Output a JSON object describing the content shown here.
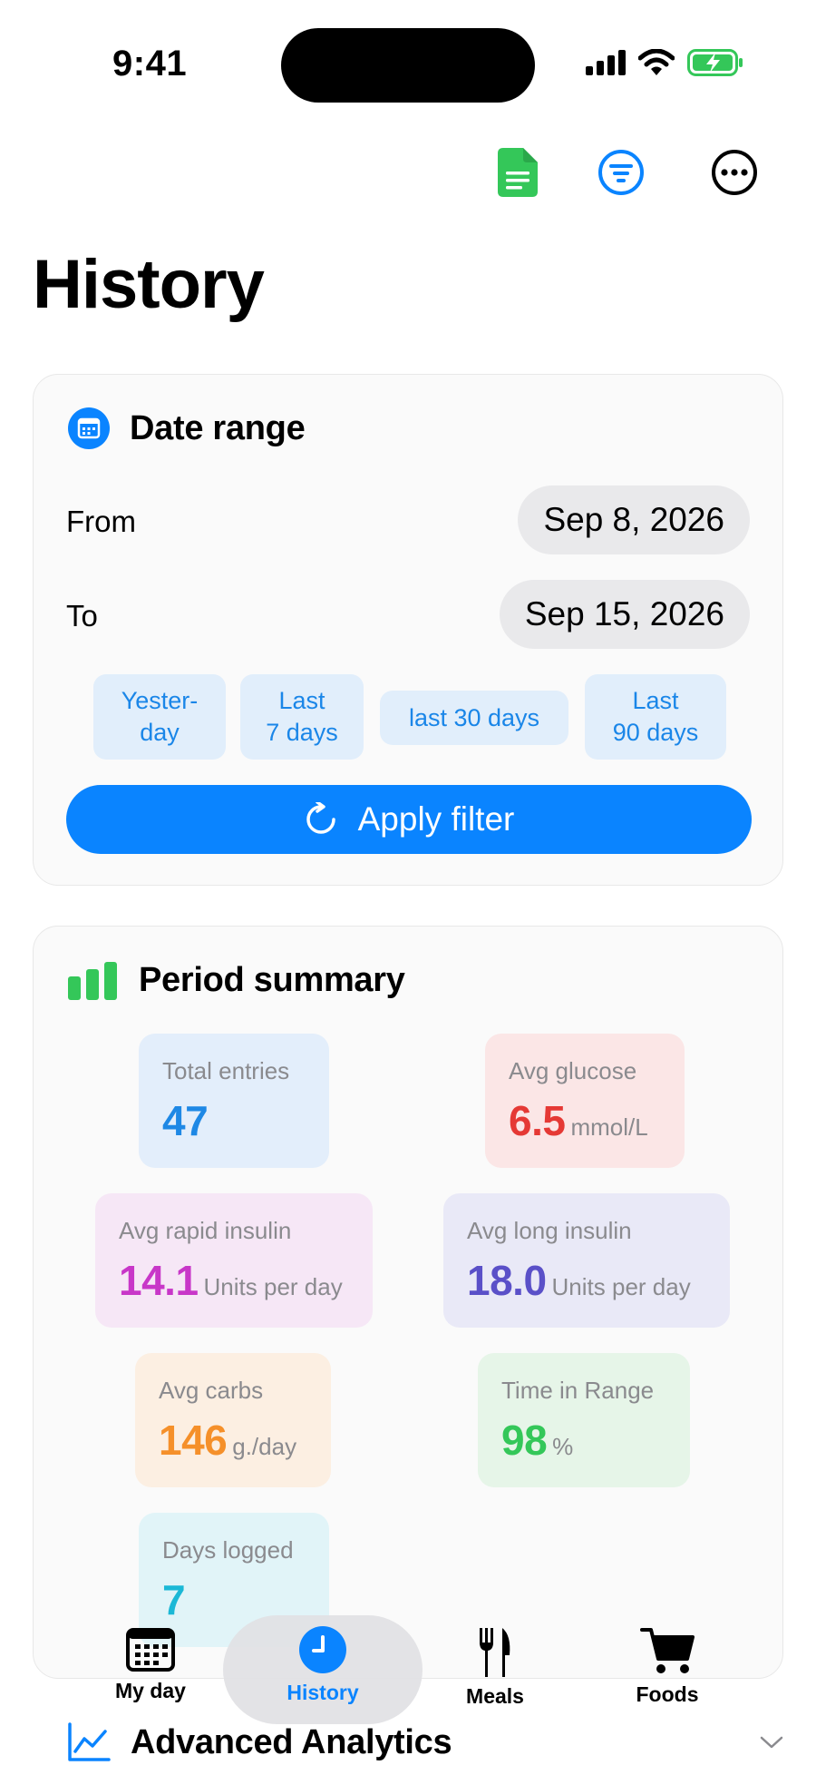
{
  "status_bar": {
    "time": "9:41"
  },
  "page": {
    "title": "History"
  },
  "date_range": {
    "title": "Date range",
    "from_label": "From",
    "from_value": "Sep 8, 2026",
    "to_label": "To",
    "to_value": "Sep 15, 2026",
    "presets": [
      {
        "label": "Yester-\nday"
      },
      {
        "label": "Last\n7 days"
      },
      {
        "label": "last 30 days"
      },
      {
        "label": "Last\n90 days"
      }
    ],
    "apply_label": "Apply filter"
  },
  "summary": {
    "title": "Period summary",
    "stats": [
      {
        "label": "Total entries",
        "value": "47",
        "unit": "",
        "color": "#1e88e5"
      },
      {
        "label": "Avg glucose",
        "value": "6.5",
        "unit": "mmol/L",
        "color": "#e53935"
      },
      {
        "label": "Avg rapid insulin",
        "value": "14.1",
        "unit": "Units per day",
        "color": "#c837c8"
      },
      {
        "label": "Avg long insulin",
        "value": "18.0",
        "unit": "Units per day",
        "color": "#5a50c8"
      },
      {
        "label": "Avg carbs",
        "value": "146",
        "unit": "g./day",
        "color": "#f5902a"
      },
      {
        "label": "Time in Range",
        "value": "98",
        "unit": "%",
        "color": "#34c759"
      },
      {
        "label": "Days logged",
        "value": "7",
        "unit": "",
        "color": "#1bb8d6"
      }
    ]
  },
  "tabs": [
    {
      "label": "My day",
      "icon": "calendar-grid-icon"
    },
    {
      "label": "History",
      "icon": "clock-icon",
      "active": true
    },
    {
      "label": "Meals",
      "icon": "fork-knife-icon"
    },
    {
      "label": "Foods",
      "icon": "cart-icon"
    }
  ],
  "analytics": {
    "title": "Advanced Analytics"
  },
  "colors": {
    "accent": "#0a84ff",
    "green": "#34c759"
  }
}
